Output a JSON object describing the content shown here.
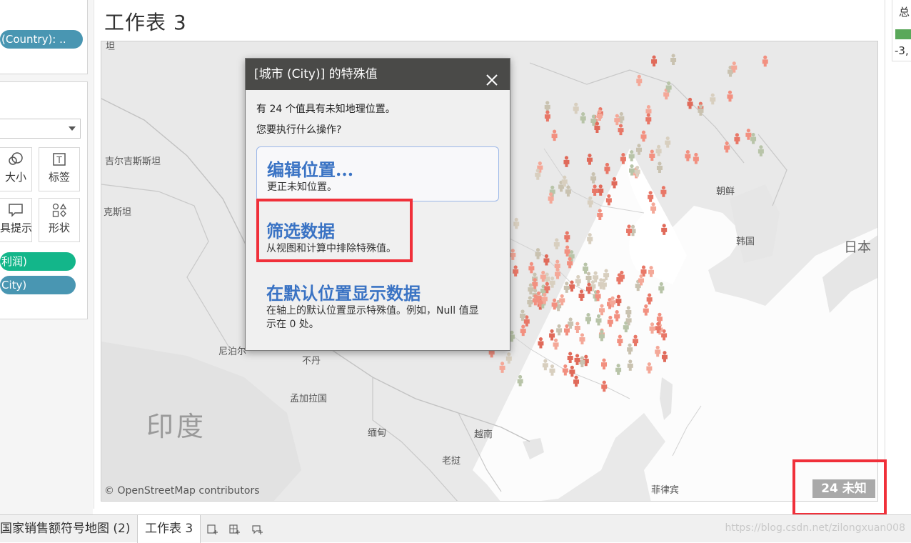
{
  "left_panel": {
    "filter_pill": "(Country): ..",
    "mark_buttons": [
      {
        "label": "大小",
        "icon": "size-icon"
      },
      {
        "label": "标签",
        "icon": "label-icon"
      },
      {
        "label": "具提示",
        "icon": "tooltip-icon"
      },
      {
        "label": "形状",
        "icon": "shape-icon"
      }
    ],
    "pill_profit": "利润)",
    "pill_city": "City)"
  },
  "sheet": {
    "title": "工作表 3"
  },
  "legend": {
    "title": "总",
    "value": "-3,"
  },
  "map": {
    "labels": {
      "kyrgyzstan": "吉尔吉斯斯坦",
      "tajikistan": "克斯坦",
      "nepal": "尼泊尔",
      "bhutan": "不丹",
      "bangladesh": "孟加拉国",
      "india": "印度",
      "myanmar": "缅甸",
      "vietnam": "越南",
      "laos": "老挝",
      "philippines": "菲律宾",
      "north_korea": "朝鲜",
      "south_korea": "韩国",
      "japan": "日本",
      "top_fragment": "坦"
    },
    "attribution": "© OpenStreetMap contributors",
    "unknown_badge": "24 未知"
  },
  "dialog": {
    "title": "[城市 (City)] 的特殊值",
    "line1": "有 24 个值具有未知地理位置。",
    "line2": "您要执行什么操作?",
    "options": [
      {
        "title": "编辑位置...",
        "desc": "更正未知位置。"
      },
      {
        "title": "筛选数据",
        "desc": "从视图和计算中排除特殊值。"
      },
      {
        "title": "在默认位置显示数据",
        "desc": "在轴上的默认位置显示特殊值。例如，Null 值显示在 0 处。"
      }
    ]
  },
  "tabs": [
    {
      "label": "国家销售额符号地图 (2)"
    },
    {
      "label": "工作表 3"
    }
  ],
  "watermark": "https://blog.csdn.net/zilongxuan008",
  "colors": {
    "accent_link": "#3a73c4",
    "highlight_box": "#f0303a",
    "pill_blue": "#4996b2",
    "pill_green": "#13b68a",
    "dialog_header": "#4a4a48"
  }
}
